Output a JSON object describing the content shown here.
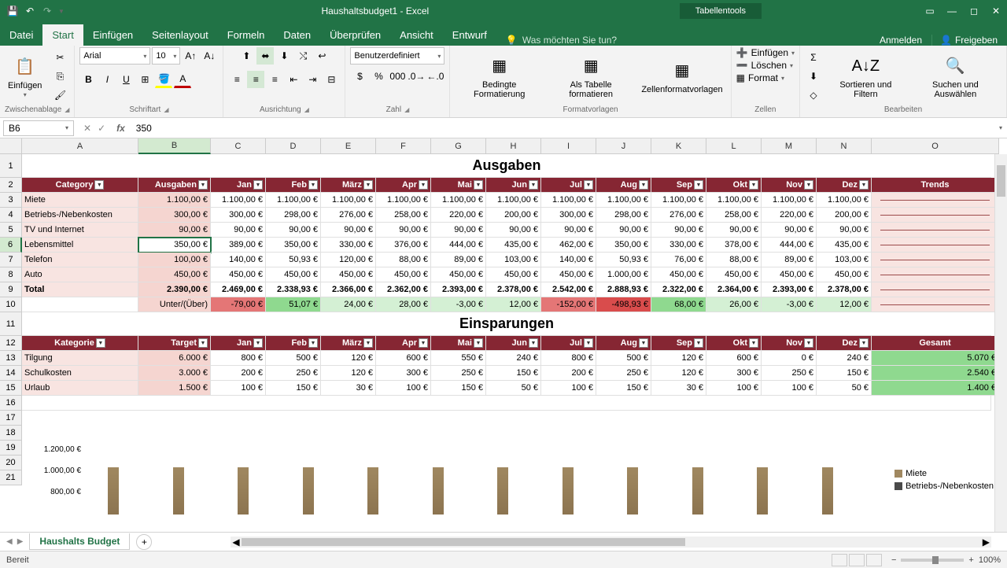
{
  "titlebar": {
    "title": "Haushaltsbudget1 - Excel",
    "tools": "Tabellentools"
  },
  "tabs": {
    "datei": "Datei",
    "start": "Start",
    "einfuegen": "Einfügen",
    "seitenlayout": "Seitenlayout",
    "formeln": "Formeln",
    "daten": "Daten",
    "ueberpruefen": "Überprüfen",
    "ansicht": "Ansicht",
    "entwurf": "Entwurf",
    "tellme": "Was möchten Sie tun?",
    "anmelden": "Anmelden",
    "freigeben": "Freigeben"
  },
  "ribbon": {
    "zwischenablage": "Zwischenablage",
    "einfuegen": "Einfügen",
    "schriftart": "Schriftart",
    "font": "Arial",
    "size": "10",
    "ausrichtung": "Ausrichtung",
    "zahl": "Zahl",
    "numformat": "Benutzerdefiniert",
    "formatvorlagen": "Formatvorlagen",
    "bedingte": "Bedingte Formatierung",
    "alstabelle": "Als Tabelle formatieren",
    "zellformat": "Zellenformatvorlagen",
    "zellen": "Zellen",
    "zellen_einfuegen": "Einfügen",
    "loeschen": "Löschen",
    "format": "Format",
    "bearbeiten": "Bearbeiten",
    "sortieren": "Sortieren und Filtern",
    "suchen": "Suchen und Auswählen"
  },
  "namebox": "B6",
  "formula": "350",
  "columns": [
    "A",
    "B",
    "C",
    "D",
    "E",
    "F",
    "G",
    "H",
    "I",
    "J",
    "K",
    "L",
    "M",
    "N",
    "O"
  ],
  "rownums": [
    "1",
    "2",
    "3",
    "4",
    "5",
    "6",
    "7",
    "8",
    "9",
    "10",
    "11",
    "12",
    "13",
    "14",
    "15",
    "16",
    "17",
    "18",
    "19",
    "20",
    "21"
  ],
  "ausgaben": {
    "title": "Ausgaben",
    "headers": [
      "Category",
      "Ausgaben",
      "Jan",
      "Feb",
      "März",
      "Apr",
      "Mai",
      "Jun",
      "Jul",
      "Aug",
      "Sep",
      "Okt",
      "Nov",
      "Dez",
      "Trends"
    ],
    "rows": [
      {
        "cat": "Miete",
        "vals": [
          "1.100,00 €",
          "1.100,00 €",
          "1.100,00 €",
          "1.100,00 €",
          "1.100,00 €",
          "1.100,00 €",
          "1.100,00 €",
          "1.100,00 €",
          "1.100,00 €",
          "1.100,00 €",
          "1.100,00 €",
          "1.100,00 €",
          "1.100,00 €"
        ]
      },
      {
        "cat": "Betriebs-/Nebenkosten",
        "vals": [
          "300,00 €",
          "300,00 €",
          "298,00 €",
          "276,00 €",
          "258,00 €",
          "220,00 €",
          "200,00 €",
          "300,00 €",
          "298,00 €",
          "276,00 €",
          "258,00 €",
          "220,00 €",
          "200,00 €"
        ]
      },
      {
        "cat": "TV und Internet",
        "vals": [
          "90,00 €",
          "90,00 €",
          "90,00 €",
          "90,00 €",
          "90,00 €",
          "90,00 €",
          "90,00 €",
          "90,00 €",
          "90,00 €",
          "90,00 €",
          "90,00 €",
          "90,00 €",
          "90,00 €"
        ]
      },
      {
        "cat": "Lebensmittel",
        "vals": [
          "350,00 €",
          "389,00 €",
          "350,00 €",
          "330,00 €",
          "376,00 €",
          "444,00 €",
          "435,00 €",
          "462,00 €",
          "350,00 €",
          "330,00 €",
          "378,00 €",
          "444,00 €",
          "435,00 €"
        ]
      },
      {
        "cat": "Telefon",
        "vals": [
          "100,00 €",
          "140,00 €",
          "50,93 €",
          "120,00 €",
          "88,00 €",
          "89,00 €",
          "103,00 €",
          "140,00 €",
          "50,93 €",
          "76,00 €",
          "88,00 €",
          "89,00 €",
          "103,00 €"
        ]
      },
      {
        "cat": "Auto",
        "vals": [
          "450,00 €",
          "450,00 €",
          "450,00 €",
          "450,00 €",
          "450,00 €",
          "450,00 €",
          "450,00 €",
          "450,00 €",
          "1.000,00 €",
          "450,00 €",
          "450,00 €",
          "450,00 €",
          "450,00 €"
        ]
      }
    ],
    "total": {
      "cat": "Total",
      "vals": [
        "2.390,00 €",
        "2.469,00 €",
        "2.338,93 €",
        "2.366,00 €",
        "2.362,00 €",
        "2.393,00 €",
        "2.378,00 €",
        "2.542,00 €",
        "2.888,93 €",
        "2.322,00 €",
        "2.364,00 €",
        "2.393,00 €",
        "2.378,00 €"
      ]
    },
    "unter": {
      "label": "Unter/(Über)",
      "vals": [
        "-79,00 €",
        "51,07 €",
        "24,00 €",
        "28,00 €",
        "-3,00 €",
        "12,00 €",
        "-152,00 €",
        "-498,93 €",
        "68,00 €",
        "26,00 €",
        "-3,00 €",
        "12,00 €"
      ]
    }
  },
  "einsparungen": {
    "title": "Einsparungen",
    "headers": [
      "Kategorie",
      "Target",
      "Jan",
      "Feb",
      "März",
      "Apr",
      "Mai",
      "Jun",
      "Jul",
      "Aug",
      "Sep",
      "Okt",
      "Nov",
      "Dez",
      "Gesamt"
    ],
    "rows": [
      {
        "cat": "Tilgung",
        "vals": [
          "6.000 €",
          "800 €",
          "500 €",
          "120 €",
          "600 €",
          "550 €",
          "240 €",
          "800 €",
          "500 €",
          "120 €",
          "600 €",
          "0 €",
          "240 €"
        ],
        "sum": "5.070 €"
      },
      {
        "cat": "Schulkosten",
        "vals": [
          "3.000 €",
          "200 €",
          "250 €",
          "120 €",
          "300 €",
          "250 €",
          "150 €",
          "200 €",
          "250 €",
          "120 €",
          "300 €",
          "250 €",
          "150 €"
        ],
        "sum": "2.540 €"
      },
      {
        "cat": "Urlaub",
        "vals": [
          "1.500 €",
          "100 €",
          "150 €",
          "30 €",
          "100 €",
          "150 €",
          "50 €",
          "100 €",
          "150 €",
          "30 €",
          "100 €",
          "100 €",
          "50 €"
        ],
        "sum": "1.400 €"
      }
    ]
  },
  "chart_data": {
    "type": "bar",
    "ylabels": [
      "1.200,00 €",
      "1.000,00 €",
      "800,00 €"
    ],
    "series": [
      {
        "name": "Miete",
        "color": "#a08860"
      },
      {
        "name": "Betriebs-/Nebenkosten",
        "color": "#4a4a4a"
      }
    ]
  },
  "sheettab": "Haushalts Budget",
  "status": "Bereit",
  "zoom": "100%"
}
